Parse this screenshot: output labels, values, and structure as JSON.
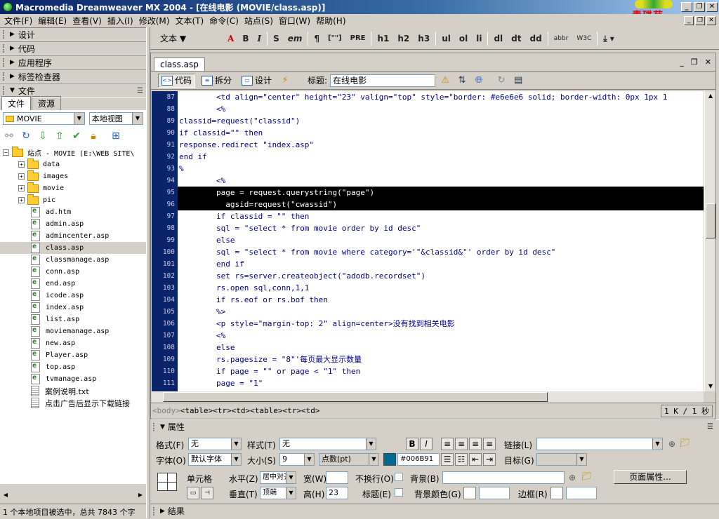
{
  "window": {
    "title": "Macromedia Dreamweaver MX 2004 - [在线电影 (MOVIE/class.asp)]",
    "logo_text": "青碟苑"
  },
  "menu": [
    "文件(F)",
    "编辑(E)",
    "查看(V)",
    "插入(I)",
    "修改(M)",
    "文本(T)",
    "命令(C)",
    "站点(S)",
    "窗口(W)",
    "帮助(H)"
  ],
  "panels": {
    "groups": [
      "设计",
      "代码",
      "应用程序",
      "标签检查器",
      "文件"
    ],
    "files_tabs": [
      "文件",
      "资源"
    ],
    "site_select": "MOVIE",
    "view_select": "本地视图",
    "site_root": "站点 - MOVIE (E:\\WEB SITE\\",
    "folders": [
      "data",
      "images",
      "movie",
      "pic"
    ],
    "files": [
      "ad.htm",
      "admin.asp",
      "admincenter.asp",
      "class.asp",
      "classmanage.asp",
      "conn.asp",
      "end.asp",
      "icode.asp",
      "index.asp",
      "list.asp",
      "moviemanage.asp",
      "new.asp",
      "Player.asp",
      "top.asp",
      "tvmanage.asp"
    ],
    "text_files": [
      "案例说明.txt",
      "点击广告后显示下载链接"
    ],
    "selected_file": "class.asp",
    "status": "1 个本地项目被选中，总共 7843 个字"
  },
  "insertbar": {
    "category": "文本",
    "buttons": [
      "B",
      "I",
      "S",
      "em",
      "¶",
      "[\"\"]",
      "PRE",
      "h1",
      "h2",
      "h3",
      "ul",
      "ol",
      "li",
      "dl",
      "dt",
      "dd",
      "abbr",
      "W3C"
    ]
  },
  "document": {
    "tab": "class.asp",
    "views": [
      "代码",
      "拆分",
      "设计"
    ],
    "title_label": "标题:",
    "title_value": "在线电影",
    "line_numbers": [
      "87",
      "88",
      "89",
      "90",
      "91",
      "92",
      "93",
      "94",
      "95",
      "96",
      "97",
      "98",
      "99",
      "100",
      "101",
      "102",
      "103",
      "104",
      "105",
      "106",
      "107",
      "108",
      "109",
      "110",
      "111"
    ],
    "code_lines": [
      "        <td align=\"center\" height=\"23\" valign=\"top\" style=\"border: #e6e6e6 solid; border-width: 0px 1px 1",
      "        <%",
      "classid=request(\"classid\")",
      "if classid=\"\" then",
      "response.redirect \"index.asp\"",
      "end if",
      "%",
      "        <%",
      "        page = request.querystring(\"page\")",
      "          agsid=request(\"cwassid\")",
      "        if classid = \"\" then",
      "        sql = \"select * from movie order by id desc\"",
      "        else",
      "        sql = \"select * from movie where category='\"&classid&\"' order by id desc\"",
      "        end if",
      "        set rs=server.createobject(\"adodb.recordset\")",
      "        rs.open sql,conn,1,1",
      "        if rs.eof or rs.bof then",
      "        %>",
      "        <p style=\"margin-top: 2\" align=center>没有找到相关电影",
      "        <%",
      "        else",
      "        rs.pagesize = \"8\"'每页最大显示数量",
      "        if page = \"\" or page < \"1\" then",
      "        page = \"1\""
    ],
    "highlighted_lines": [
      8,
      9
    ],
    "tag_path": [
      "<body>",
      "<table>",
      "<tr>",
      "<td>",
      "<table>",
      "<tr>",
      "<td>"
    ],
    "size": "1 K / 1 秒"
  },
  "properties": {
    "header": "属性",
    "format_label": "格式(F)",
    "format_value": "无",
    "style_label": "样式(T)",
    "style_value": "无",
    "font_label": "字体(O)",
    "font_value": "默认字体",
    "size_label": "大小(S)",
    "size_value": "9",
    "unit_value": "点数(pt)",
    "color_value": "#006B91",
    "link_label": "链接(L)",
    "link_value": "",
    "target_label": "目标(G)",
    "target_value": "",
    "cell_label": "单元格",
    "horz_label": "水平(Z)",
    "horz_value": "居中对齐",
    "vert_label": "垂直(T)",
    "vert_value": "顶端",
    "width_label": "宽(W)",
    "width_value": "",
    "height_label": "高(H)",
    "height_value": "23",
    "nowrap_label": "不换行(O)",
    "header_label": "标题(E)",
    "bg_label": "背景(B)",
    "bg_value": "",
    "bgcolor_label": "背景颜色(G)",
    "bgcolor_value": "",
    "border_label": "边框(R)",
    "border_value": "",
    "page_props_button": "页面属性..."
  },
  "results": {
    "header": "结果"
  }
}
